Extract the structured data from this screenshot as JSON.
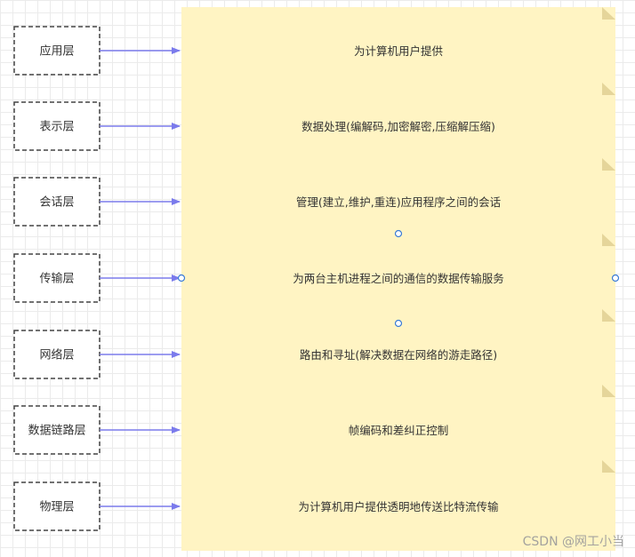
{
  "layers": [
    {
      "name": "应用层",
      "function": "为计算机用户提供"
    },
    {
      "name": "表示层",
      "function": "数据处理(编解码,加密解密,压缩解压缩)"
    },
    {
      "name": "会话层",
      "function": "管理(建立,维护,重连)应用程序之间的会话"
    },
    {
      "name": "传输层",
      "function": "为两台主机进程之间的通信的数据传输服务"
    },
    {
      "name": "网络层",
      "function": "路由和寻址(解决数据在网络的游走路径)"
    },
    {
      "name": "数据链路层",
      "function": "帧编码和差纠正控制"
    },
    {
      "name": "物理层",
      "function": "为计算机用户提供透明地传送比特流传输"
    }
  ],
  "watermark": "CSDN @网工小当",
  "colors": {
    "note_fill": "#fff4c3",
    "note_fold": "#e5d59a",
    "arrow": "#7b7bec",
    "box_border": "#444444",
    "handle": "#3a7bd5"
  }
}
